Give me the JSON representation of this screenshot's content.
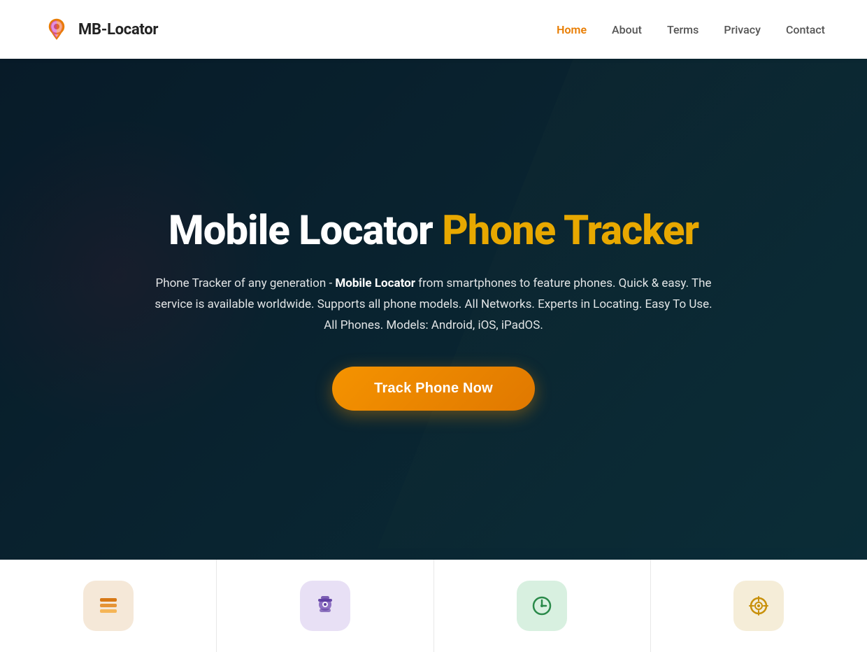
{
  "navbar": {
    "logo_text": "MB-Locator",
    "nav_items": [
      {
        "label": "Home",
        "active": true
      },
      {
        "label": "About",
        "active": false
      },
      {
        "label": "Terms",
        "active": false
      },
      {
        "label": "Privacy",
        "active": false
      },
      {
        "label": "Contact",
        "active": false
      }
    ]
  },
  "hero": {
    "title_main": "Mobile Locator ",
    "title_accent": "Phone Tracker",
    "subtitle_prefix": "Phone Tracker of any generation - ",
    "subtitle_brand": "Mobile Locator",
    "subtitle_suffix": " from smartphones to feature phones. Quick & easy. The service is available worldwide. Supports all phone models. All Networks. Experts in Locating. Easy To Use. All Phones. Models: Android, iOS, iPadOS.",
    "cta_label": "Track Phone Now"
  },
  "features": {
    "cards": [
      {
        "icon": "🗂",
        "color": "orange"
      },
      {
        "icon": "🕵",
        "color": "purple"
      },
      {
        "icon": "🕐",
        "color": "green"
      },
      {
        "icon": "✚",
        "color": "yellow"
      }
    ]
  },
  "colors": {
    "accent": "#e8a800",
    "nav_active": "#e87c00",
    "cta_bg_start": "#f59300",
    "cta_bg_end": "#e07800"
  }
}
